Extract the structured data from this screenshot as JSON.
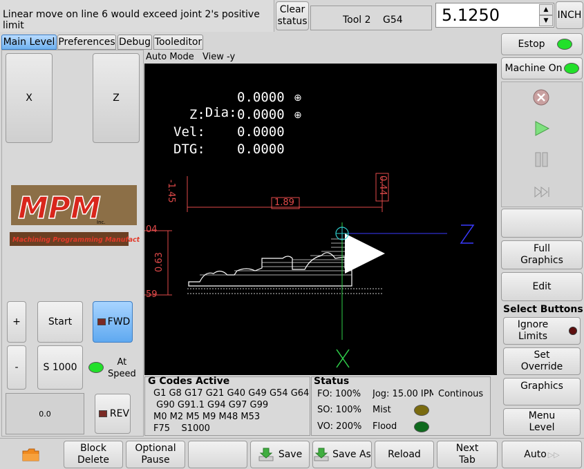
{
  "header": {
    "message": "Linear move on line 6 would exceed joint 2's positive limit",
    "clear_status": "Clear\nstatus",
    "tool": "Tool 2",
    "offset": "G54",
    "spin_value": "5.1250",
    "units": "INCH"
  },
  "tabs": [
    {
      "label": "Main Level",
      "active": true
    },
    {
      "label": "Preferences",
      "active": false
    },
    {
      "label": "Debug",
      "active": false
    },
    {
      "label": "Tooleditor",
      "active": false
    }
  ],
  "left": {
    "jog_x": "X",
    "jog_z": "Z",
    "logo_main": "MPM",
    "logo_inc": "Inc.",
    "logo_tagline": "Machining Programming Manufacturing",
    "plus": "+",
    "minus": "-",
    "start": "Start",
    "fwd": "FWD",
    "speed": "S 1000",
    "at_speed": "At\nSpeed",
    "rpm": "0.0",
    "rev": "REV"
  },
  "graphics": {
    "mode": "Auto Mode",
    "view": "View -y",
    "dro": [
      {
        "label": "Dia:",
        "value": "0.0000"
      },
      {
        "label": "  Z:",
        "value": "0.0000"
      },
      {
        "label": "Vel:",
        "value": "0.0000"
      },
      {
        "label": "DTG:",
        "value": "0.0000"
      }
    ],
    "dim_left": "-1.45",
    "dim_right": "0.44",
    "dim_width": "1.89",
    "dim_top": "04",
    "dim_height": "0.63",
    "dim_bottom": "59",
    "axis_z": "Z",
    "axis_x": "X"
  },
  "gcodes": {
    "title": "G Codes Active",
    "lines": [
      "G1 G8 G17 G21 G40 G49 G54 G64",
      " G90 G91.1 G94 G97 G99",
      "M0 M2 M5 M9 M48 M53",
      "F75    S1000"
    ]
  },
  "status": {
    "title": "Status",
    "fo": "FO: 100%",
    "so": "SO: 100%",
    "vo": "VO: 200%",
    "jog": "Jog: 15.00 IPM",
    "jog_mode": "Continous",
    "mist": "Mist",
    "flood": "Flood",
    "mist_color": "#7a6b10",
    "flood_color": "#0f6a1e"
  },
  "right": {
    "estop": "Estop",
    "machine_on": "Machine On",
    "estop_led": "#22e02a",
    "machine_led": "#22e02a",
    "stop_icon": "stop-icon",
    "run_icon": "play-icon",
    "pause_icon": "pause-icon",
    "step_icon": "step-icon",
    "full_graphics": "Full\nGraphics",
    "edit": "Edit",
    "select_buttons": "Select Buttons",
    "ignore_limits": "Ignore\nLimits",
    "set_override": "Set\nOverride",
    "graphics": "Graphics",
    "menu_level": "Menu\nLevel",
    "auto": "Auto"
  },
  "bottom": {
    "folder_icon": "folder-icon",
    "block_delete": "Block\nDelete",
    "optional_pause": "Optional\nPause",
    "save": "Save",
    "save_as": "Save As",
    "reload": "Reload",
    "next_tab": "Next\nTab"
  }
}
